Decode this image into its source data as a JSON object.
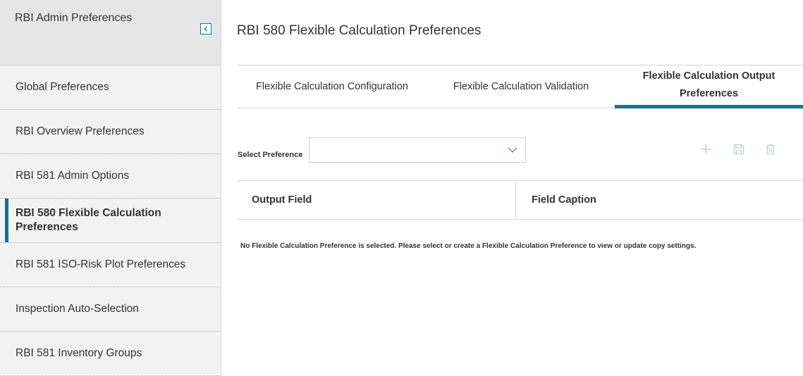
{
  "sidebar": {
    "title": "RBI Admin Preferences",
    "items": [
      {
        "label": "Global Preferences",
        "active": false
      },
      {
        "label": "RBI Overview Preferences",
        "active": false
      },
      {
        "label": "RBI 581 Admin Options",
        "active": false
      },
      {
        "label": "RBI 580 Flexible Calculation Preferences",
        "active": true
      },
      {
        "label": "RBI 581 ISO-Risk Plot Preferences",
        "active": false
      },
      {
        "label": "Inspection Auto-Selection",
        "active": false
      },
      {
        "label": "RBI 581 Inventory Groups",
        "active": false
      }
    ]
  },
  "main": {
    "title": "RBI 580 Flexible Calculation Preferences",
    "tabs": [
      {
        "label": "Flexible Calculation Configuration",
        "active": false
      },
      {
        "label": "Flexible Calculation Validation",
        "active": false
      },
      {
        "label": "Flexible Calculation Output Preferences",
        "active": true
      }
    ],
    "select_label": "Select Preference",
    "select_value": "",
    "columns": [
      "Output Field",
      "Field Caption"
    ],
    "message": "No Flexible Calculation Preference is selected. Please select or create a Flexible Calculation Preference to view or update copy settings."
  },
  "icons": {
    "collapse": "chevron-left-icon",
    "add": "plus-icon",
    "save": "save-icon",
    "delete": "trash-icon",
    "select_arrow": "chevron-down-icon"
  },
  "colors": {
    "accent": "#1f6e8c",
    "icon_disabled": "#b8d4df"
  }
}
